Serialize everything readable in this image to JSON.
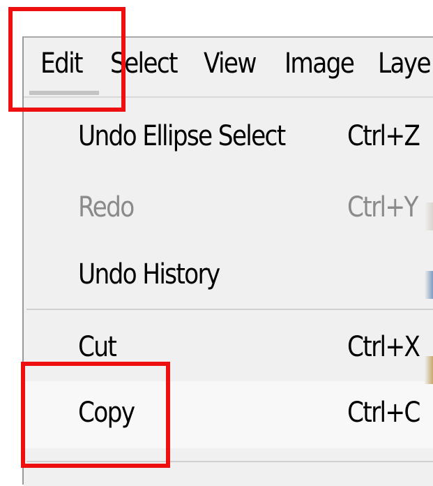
{
  "colors": {
    "menu_background": "#f0f0f0",
    "hover_background": "#f8f8f8",
    "disabled_text": "#8a8a8a",
    "annotation_red": "#ee1010",
    "separator": "#cfcfcf"
  },
  "menubar": {
    "items": [
      {
        "label": "Edit",
        "active": true
      },
      {
        "label": "Select"
      },
      {
        "label": "View"
      },
      {
        "label": "Image"
      },
      {
        "label": "Laye"
      }
    ]
  },
  "edit_menu": {
    "items": [
      {
        "label": "Undo Ellipse Select",
        "shortcut": "Ctrl+Z",
        "enabled": true
      },
      {
        "label": "Redo",
        "shortcut": "Ctrl+Y",
        "enabled": false
      },
      {
        "label": "Undo History",
        "shortcut": "",
        "enabled": true
      },
      {
        "label": "Cut",
        "shortcut": "Ctrl+X",
        "enabled": true
      },
      {
        "label": "Copy",
        "shortcut": "Ctrl+C",
        "enabled": true,
        "hovered": true
      }
    ]
  },
  "annotations": [
    {
      "target": "Edit menu",
      "color": "#ee1010"
    },
    {
      "target": "Copy item",
      "color": "#ee1010"
    }
  ]
}
